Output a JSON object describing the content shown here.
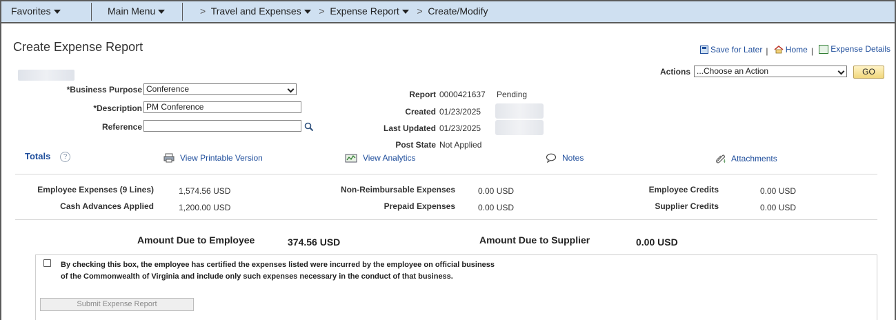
{
  "nav": {
    "favorites": "Favorites",
    "main_menu": "Main Menu",
    "breadcrumb": [
      {
        "label": "Travel and Expenses"
      },
      {
        "label": "Expense Report"
      },
      {
        "label": "Create/Modify"
      }
    ]
  },
  "page": {
    "title": "Create Expense Report"
  },
  "toplinks": {
    "save_later": "Save for Later",
    "home": "Home",
    "expense_details": "Expense Details"
  },
  "actions": {
    "label": "Actions",
    "selected": "...Choose an Action",
    "go": "GO"
  },
  "form": {
    "business_purpose_label": "*Business Purpose",
    "business_purpose_value": "Conference",
    "description_label": "*Description",
    "description_value": "PM Conference",
    "reference_label": "Reference",
    "reference_value": ""
  },
  "report_info": {
    "report_label": "Report",
    "report_value": "0000421637",
    "report_status": "Pending",
    "created_label": "Created",
    "created_value": "01/23/2025",
    "last_updated_label": "Last Updated",
    "last_updated_value": "01/23/2025",
    "post_state_label": "Post State",
    "post_state_value": "Not Applied"
  },
  "totals": {
    "label": "Totals",
    "links": {
      "printable": "View Printable Version",
      "analytics": "View Analytics",
      "notes": "Notes",
      "attachments": "Attachments"
    },
    "employee_expenses_label": "Employee Expenses (9 Lines)",
    "employee_expenses_value": "1,574.56",
    "cash_advances_label": "Cash Advances Applied",
    "cash_advances_value": "1,200.00",
    "non_reimbursable_label": "Non-Reimbursable Expenses",
    "non_reimbursable_value": "0.00",
    "prepaid_label": "Prepaid Expenses",
    "prepaid_value": "0.00",
    "employee_credits_label": "Employee Credits",
    "employee_credits_value": "0.00",
    "supplier_credits_label": "Supplier Credits",
    "supplier_credits_value": "0.00",
    "currency": "USD"
  },
  "amounts": {
    "due_employee_label": "Amount Due to Employee",
    "due_employee_value": "374.56",
    "due_supplier_label": "Amount Due to Supplier",
    "due_supplier_value": "0.00",
    "currency": "USD"
  },
  "certification": {
    "text": "By checking this box, the employee has certified the expenses listed were incurred by the employee on official business of the Commonwealth of Virginia and include only such expenses necessary in the conduct of that business.",
    "submit": "Submit Expense Report"
  },
  "colors": {
    "nav_bg": "#cfe0f1",
    "link": "#1f4e9c",
    "go_button": "#f1d77c"
  }
}
